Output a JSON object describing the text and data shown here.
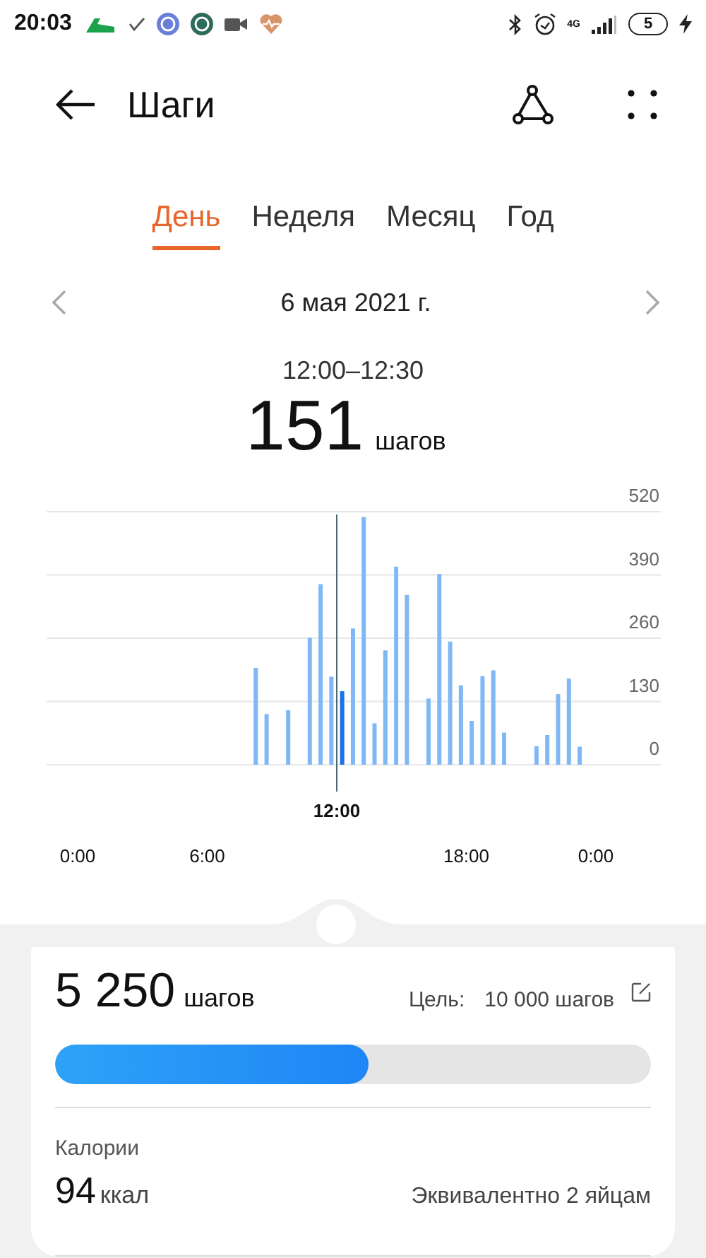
{
  "status_bar": {
    "time": "20:03",
    "network": "4G",
    "battery": "5"
  },
  "header": {
    "title": "Шаги"
  },
  "tabs": [
    {
      "label": "День",
      "selected": true
    },
    {
      "label": "Неделя",
      "selected": false
    },
    {
      "label": "Месяц",
      "selected": false
    },
    {
      "label": "Год",
      "selected": false
    }
  ],
  "date_nav": {
    "date": "6 мая 2021 г."
  },
  "selection": {
    "range": "12:00–12:30",
    "value": "151",
    "unit": "шагов"
  },
  "chart": {
    "chart_data": {
      "type": "bar",
      "x": [
        8,
        8.5,
        9.5,
        10.5,
        11,
        11.5,
        12,
        12.5,
        13,
        13.5,
        14,
        14.5,
        15,
        16,
        16.5,
        17,
        17.5,
        18,
        18.5,
        19,
        19.5,
        21,
        21.5,
        22,
        22.5,
        23
      ],
      "values": [
        199,
        104,
        112,
        261,
        371,
        181,
        151,
        280,
        509,
        85,
        235,
        407,
        349,
        136,
        392,
        253,
        163,
        90,
        182,
        194,
        66,
        38,
        61,
        145,
        177,
        37
      ],
      "xticks": [
        {
          "value": 0,
          "label": "0:00"
        },
        {
          "value": 6,
          "label": "6:00"
        },
        {
          "value": 18,
          "label": "18:00"
        },
        {
          "value": 24,
          "label": "0:00"
        }
      ],
      "yticks": [
        0,
        130,
        260,
        390,
        520
      ],
      "xlim": [
        0,
        24
      ],
      "ylim": [
        0,
        520
      ],
      "grid": true,
      "ref_lines": [
        {
          "axis": "x",
          "value": 12,
          "label": "12:00"
        }
      ]
    }
  },
  "summary": {
    "steps": "5 250",
    "steps_unit": "шагов",
    "goal_label": "Цель:",
    "goal_value": "10 000 шагов",
    "level": 0.525
  },
  "calories": {
    "label": "Калории",
    "value": "94",
    "unit": "ккал",
    "equivalent": "Эквивалентно 2 яйцам"
  }
}
